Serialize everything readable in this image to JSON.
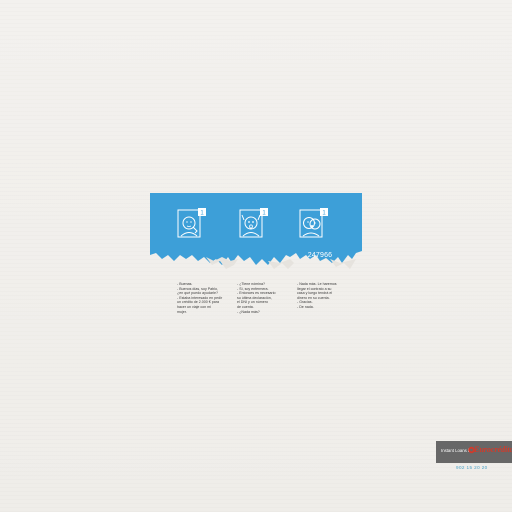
{
  "colors": {
    "strip_blue": "#3d9fd8",
    "icon_white": "#ffffff",
    "footer_gray": "#676767",
    "brand_red": "#d23a2a",
    "phone_blue": "#4aa3c8"
  },
  "ticket": {
    "number": "247966",
    "frame_badge": "1"
  },
  "dialogue": {
    "col1": [
      "- Buenas.",
      "- Buenos días, soy Pablo,",
      "  ¿en qué puedo ayudarle?",
      "- Estaba interesado en pedir",
      "  un crédito de 2.000 € para",
      "  hacer un viaje con mi",
      "  mujer."
    ],
    "col2": [
      "- ¿Tiene nómina?",
      "- Sí, soy enfermera.",
      "- Entonces es necesario",
      "  su última declaración,",
      "  el DNI y un número",
      "  de cuenta.",
      "- ¿Nada más?"
    ],
    "col3": [
      "- Nada más. Le haremos",
      "  llegar el contrato a su",
      "  casa y luego tendrá el",
      "  dinero en su cuenta.",
      "- Gracias.",
      "- De nada."
    ]
  },
  "footer": {
    "label": "Instant Loans by",
    "brand": "Eurocrédito",
    "phone": "902 15 20 20"
  }
}
